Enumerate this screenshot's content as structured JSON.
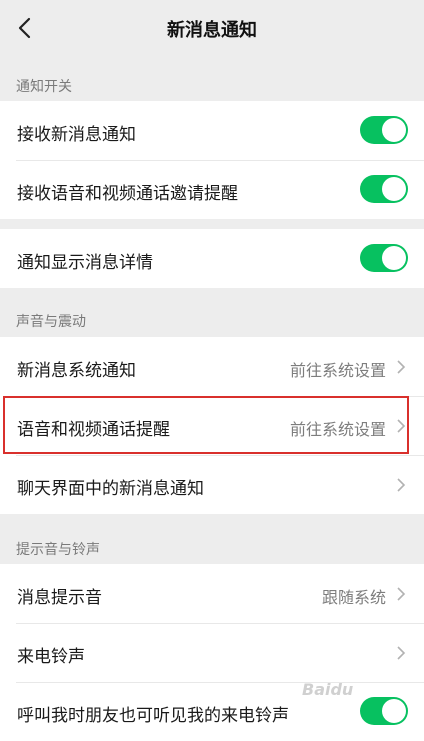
{
  "header": {
    "title": "新消息通知"
  },
  "sections": {
    "notify_switch": {
      "label": "通知开关",
      "rows": [
        {
          "label": "接收新消息通知",
          "toggle": true
        },
        {
          "label": "接收语音和视频通话邀请提醒",
          "toggle": true
        }
      ]
    },
    "details": {
      "rows": [
        {
          "label": "通知显示消息详情",
          "toggle": true
        }
      ]
    },
    "sound_vibrate": {
      "label": "声音与震动",
      "rows": [
        {
          "label": "新消息系统通知",
          "value": "前往系统设置"
        },
        {
          "label": "语音和视频通话提醒",
          "value": "前往系统设置"
        },
        {
          "label": "聊天界面中的新消息通知",
          "value": ""
        }
      ]
    },
    "ringtone": {
      "label": "提示音与铃声",
      "rows": [
        {
          "label": "消息提示音",
          "value": "跟随系统"
        },
        {
          "label": "来电铃声",
          "value": ""
        },
        {
          "label": "呼叫我时朋友也可听见我的来电铃声",
          "toggle": true
        }
      ]
    }
  },
  "colors": {
    "toggle_on": "#07c160",
    "highlight": "#d9302c"
  },
  "watermark": "Baidu"
}
